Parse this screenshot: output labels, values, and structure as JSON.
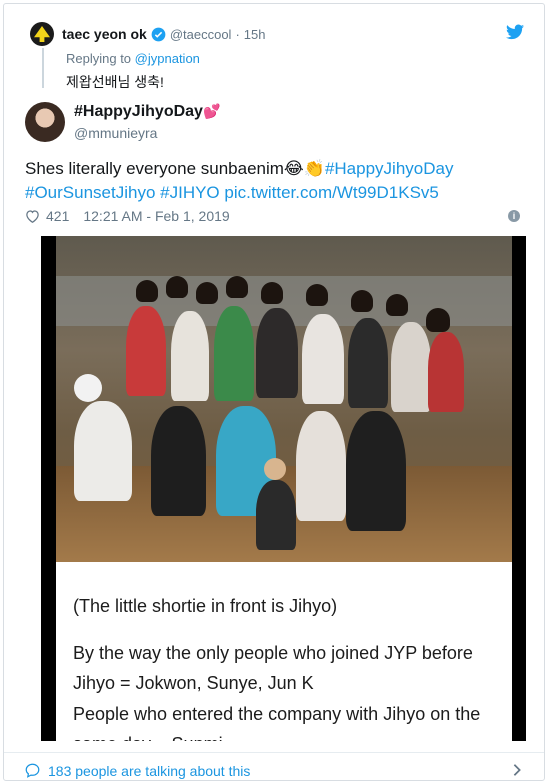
{
  "retweet_header": {
    "name": "taec yeon ok",
    "handle": "@taeccool",
    "separator": "·",
    "time": "15h",
    "replying_prefix": "Replying to",
    "replying_to": "@jypnation",
    "korean_text": "제왑선배님 생축!"
  },
  "quoted": {
    "name": "#HappyJihyoDay",
    "name_emoji": "💕",
    "handle": "@mmunieyra",
    "text_plain": "Shes literally everyone sunbaenim",
    "emojis": "😂👏",
    "hashtag1": "#HappyJihyoDay",
    "hashtag2": "#OurSunsetJihyo",
    "hashtag3": "#JIHYO",
    "link": "pic.twitter.com/Wt99D1KSv5",
    "likes": "421",
    "timestamp": "12:21 AM - Feb 1, 2019"
  },
  "media": {
    "caption1": "(The little shortie in front is Jihyo)",
    "caption2": "By the way the only people who joined JYP before",
    "caption3": "Jihyo = Jokwon, Sunye, Jun K",
    "caption4": "People who entered the company with Jihyo on the",
    "caption5": "same day = Sunmi"
  },
  "footer": {
    "talking": "183 people are talking about this"
  },
  "icons": {
    "verified": "verified-badge-icon",
    "bird": "twitter-bird-icon",
    "heart": "heart-icon",
    "info": "info-icon",
    "chat": "chat-bubble-icon",
    "chevron": "chevron-right-icon"
  },
  "colors": {
    "link_blue": "#1b95e0",
    "gray": "#657786",
    "text": "#14171a"
  }
}
